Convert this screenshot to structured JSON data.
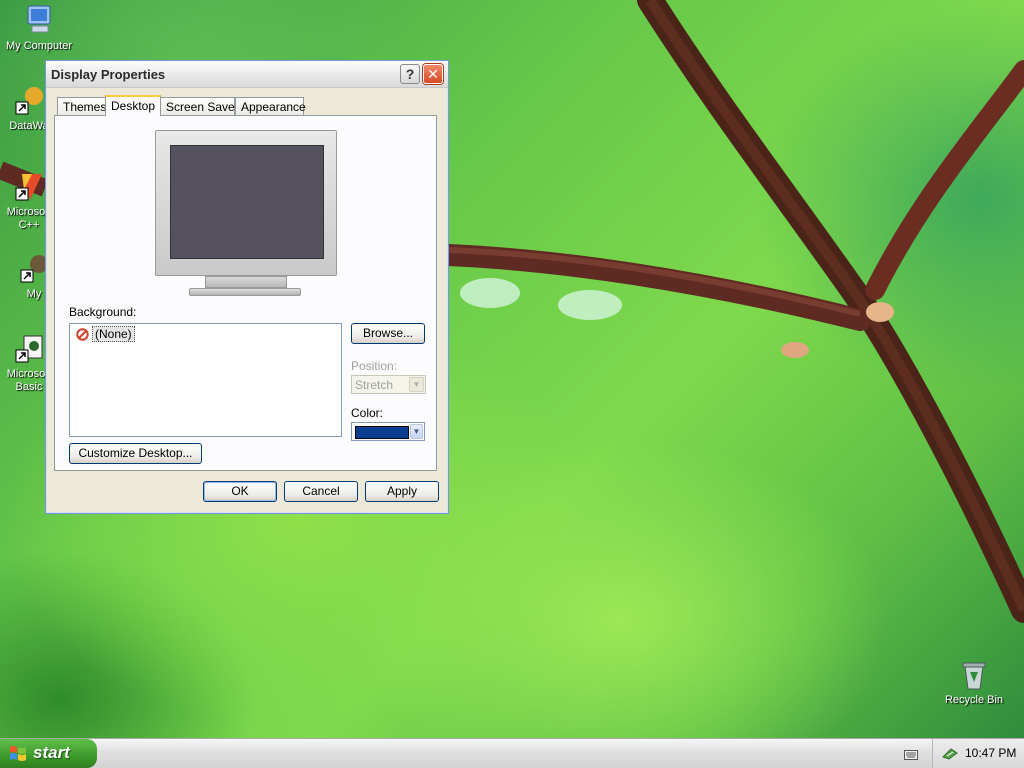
{
  "desktop": {
    "icons": [
      {
        "label": "My Computer"
      },
      {
        "label": "DataWa"
      },
      {
        "label": "Microsoft",
        "label2": "C++"
      },
      {
        "label": "My"
      },
      {
        "label": "Microsoft",
        "label2": "Basic"
      },
      {
        "label": "Recycle Bin"
      }
    ]
  },
  "window": {
    "title": "Display Properties",
    "help_label": "?",
    "close_label": "✕",
    "tabs": [
      {
        "label": "Themes"
      },
      {
        "label": "Desktop"
      },
      {
        "label": "Screen Saver"
      },
      {
        "label": "Appearance"
      }
    ],
    "active_tab": "Desktop",
    "background_label": "Background:",
    "background_items": [
      {
        "label": "(None)",
        "selected": true
      }
    ],
    "browse_label": "Browse...",
    "position_label": "Position:",
    "position_value": "Stretch",
    "color_label": "Color:",
    "color_value": "#0b3d91",
    "customize_label": "Customize Desktop...",
    "ok_label": "OK",
    "cancel_label": "Cancel",
    "apply_label": "Apply"
  },
  "taskbar": {
    "start_label": "start",
    "clock": "10:47 PM"
  },
  "colors": {
    "monitor_screen": "#55515f",
    "start_green": "#3c9a2a"
  }
}
